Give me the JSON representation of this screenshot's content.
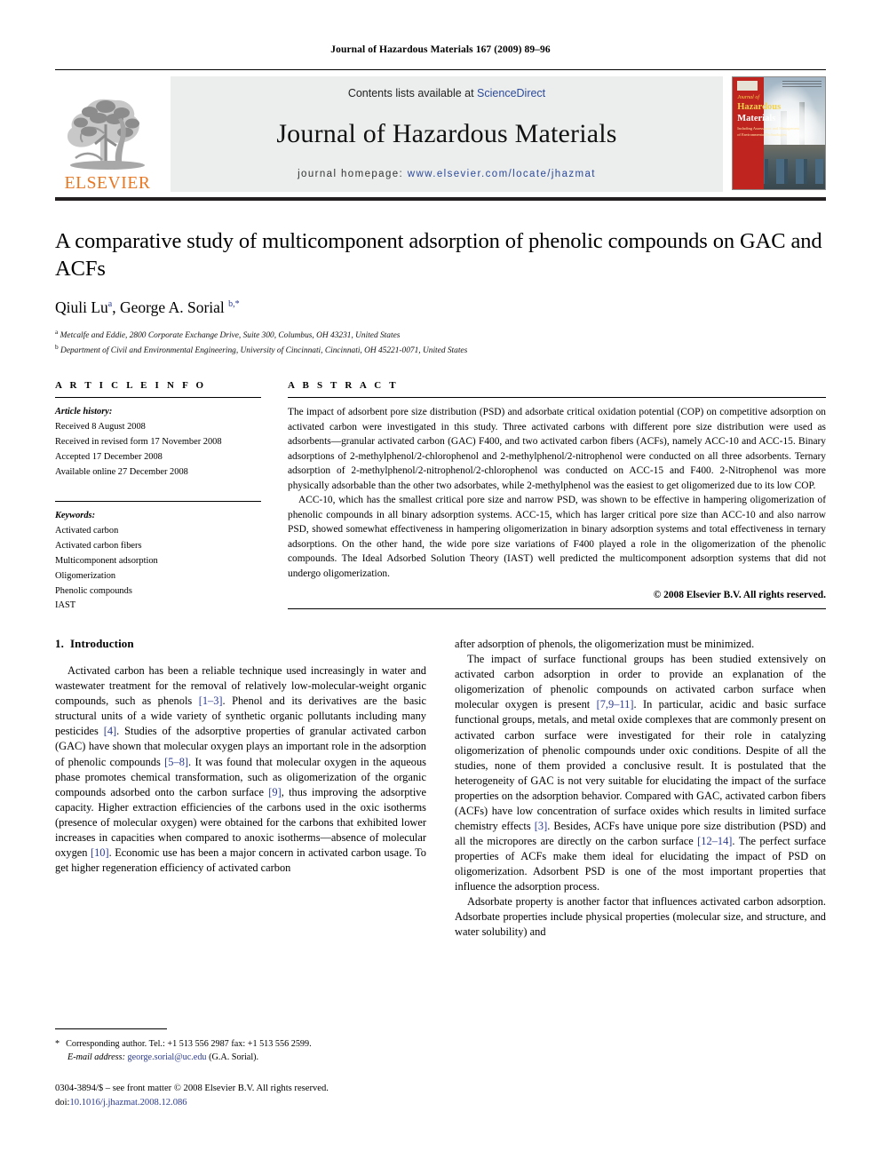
{
  "running_head": "Journal of Hazardous Materials 167 (2009) 89–96",
  "masthead": {
    "contents_prefix": "Contents lists available at ",
    "sciencedirect": "ScienceDirect",
    "journal_title": "Journal of Hazardous Materials",
    "homepage_prefix": "journal homepage: ",
    "homepage_url": "www.elsevier.com/locate/jhazmat",
    "publisher": "ELSEVIER",
    "cover": {
      "line1": "Journal of",
      "line2": "Hazardous",
      "line3": "Materials",
      "subtitle": "Including Assessment and Management\nof Environmental Technologies"
    },
    "link_color": "#2b4a9b",
    "brand_color": "#E87722"
  },
  "article": {
    "title": "A comparative study of multicomponent adsorption of phenolic compounds on GAC and ACFs",
    "authors": "Qiuli Lu",
    "author1_marker": "a",
    "author2": ", George A. Sorial ",
    "author2_marker": "b,*",
    "affiliation_a_marker": "a",
    "affiliation_a": " Metcalfe and Eddie, 2800 Corporate Exchange Drive, Suite 300, Columbus, OH 43231, United States",
    "affiliation_b_marker": "b",
    "affiliation_b": " Department of Civil and Environmental Engineering, University of Cincinnati, Cincinnati, OH 45221-0071, United States"
  },
  "article_info": {
    "heading": "A R T I C L E   I N F O",
    "history_label": "Article history:",
    "history": [
      "Received 8 August 2008",
      "Received in revised form 17 November 2008",
      "Accepted 17 December 2008",
      "Available online 27 December 2008"
    ],
    "keywords_label": "Keywords:",
    "keywords": [
      "Activated carbon",
      "Activated carbon fibers",
      "Multicomponent adsorption",
      "Oligomerization",
      "Phenolic compounds",
      "IAST"
    ]
  },
  "abstract": {
    "heading": "A B S T R A C T",
    "paragraph1": "The impact of adsorbent pore size distribution (PSD) and adsorbate critical oxidation potential (COP) on competitive adsorption on activated carbon were investigated in this study. Three activated carbons with different pore size distribution were used as adsorbents—granular activated carbon (GAC) F400, and two activated carbon fibers (ACFs), namely ACC-10 and ACC-15. Binary adsorptions of 2-methylphenol/2-chlorophenol and 2-methylphenol/2-nitrophenol were conducted on all three adsorbents. Ternary adsorption of 2-methylphenol/2-nitrophenol/2-chlorophenol was conducted on ACC-15 and F400. 2-Nitrophenol was more physically adsorbable than the other two adsorbates, while 2-methylphenol was the easiest to get oligomerized due to its low COP.",
    "paragraph2": "ACC-10, which has the smallest critical pore size and narrow PSD, was shown to be effective in hampering oligomerization of phenolic compounds in all binary adsorption systems. ACC-15, which has larger critical pore size than ACC-10 and also narrow PSD, showed somewhat effectiveness in hampering oligomerization in binary adsorption systems and total effectiveness in ternary adsorptions. On the other hand, the wide pore size variations of F400 played a role in the oligomerization of the phenolic compounds. The Ideal Adsorbed Solution Theory (IAST) well predicted the multicomponent adsorption systems that did not undergo oligomerization.",
    "copyright": "© 2008 Elsevier B.V. All rights reserved."
  },
  "introduction": {
    "number": "1.",
    "heading": "Introduction",
    "left_p1_part1": "Activated carbon has been a reliable technique used increasingly in water and wastewater treatment for the removal of relatively low-molecular-weight organic compounds, such as phenols ",
    "left_cite1": "[1–3]",
    "left_p1_part2": ". Phenol and its derivatives are the basic structural units of a wide variety of synthetic organic pollutants including many pesticides ",
    "left_cite2": "[4]",
    "left_p1_part3": ". Studies of the adsorptive properties of granular activated carbon (GAC) have shown that molecular oxygen plays an important role in the adsorption of phenolic compounds ",
    "left_cite3": "[5–8]",
    "left_p1_part4": ". It was found that molecular oxygen in the aqueous phase promotes chemical transformation, such as oligomerization of the organic compounds adsorbed onto the carbon surface ",
    "left_cite4": "[9]",
    "left_p1_part5": ", thus improving the adsorptive capacity. Higher extraction efficiencies of the carbons used in the oxic isotherms (presence of molecular oxygen) were obtained for the carbons that exhibited lower increases in capacities when compared to anoxic isotherms—absence of molecular oxygen ",
    "left_cite5": "[10]",
    "left_p1_part6": ". Economic use has been a major concern in activated carbon usage. To get higher regeneration efficiency of activated carbon",
    "right_p1_cont": "after adsorption of phenols, the oligomerization must be minimized.",
    "right_p2_part1": "The impact of surface functional groups has been studied extensively on activated carbon adsorption in order to provide an explanation of the oligomerization of phenolic compounds on activated carbon surface when molecular oxygen is present ",
    "right_cite1": "[7,9–11]",
    "right_p2_part2": ". In particular, acidic and basic surface functional groups, metals, and metal oxide complexes that are commonly present on activated carbon surface were investigated for their role in catalyzing oligomerization of phenolic compounds under oxic conditions. Despite of all the studies, none of them provided a conclusive result. It is postulated that the heterogeneity of GAC is not very suitable for elucidating the impact of the surface properties on the adsorption behavior. Compared with GAC, activated carbon fibers (ACFs) have low concentration of surface oxides which results in limited surface chemistry effects ",
    "right_cite2": "[3]",
    "right_p2_part3": ". Besides, ACFs have unique pore size distribution (PSD) and all the micropores are directly on the carbon surface ",
    "right_cite3": "[12–14]",
    "right_p2_part4": ". The perfect surface properties of ACFs make them ideal for elucidating the impact of PSD on oligomerization. Adsorbent PSD is one of the most important properties that influence the adsorption process.",
    "right_p3": "Adsorbate property is another factor that influences activated carbon adsorption. Adsorbate properties include physical properties (molecular size, and structure, and water solubility) and"
  },
  "footnote": {
    "star": "*",
    "corresponding": "Corresponding author. Tel.: +1 513 556 2987 fax: +1 513 556 2599.",
    "email_label": "E-mail address:",
    "email": " george.sorial@uc.edu",
    "email_suffix": " (G.A. Sorial).",
    "issn_line": "0304-3894/$ – see front matter © 2008 Elsevier B.V. All rights reserved.",
    "doi_prefix": "doi:",
    "doi": "10.1016/j.jhazmat.2008.12.086"
  }
}
